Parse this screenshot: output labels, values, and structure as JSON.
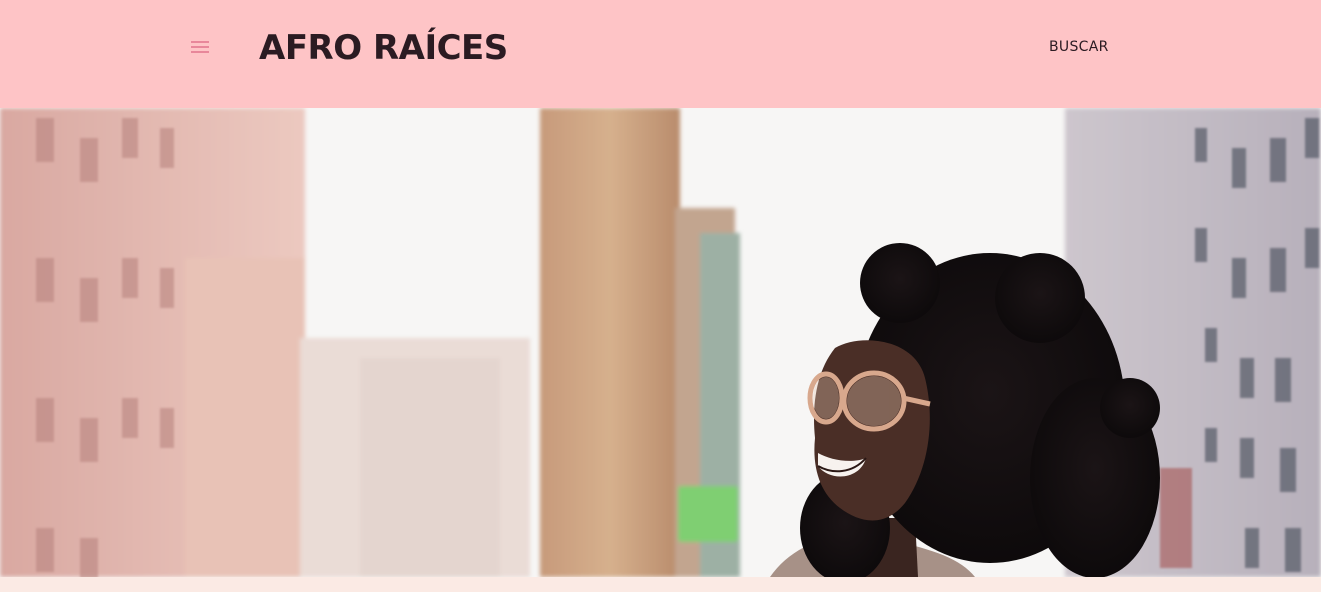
{
  "header": {
    "menu_icon": "hamburger-menu-icon",
    "logo_text": "AFRO RAÍCES",
    "search_label": "BUSCAR",
    "background_color": "#fec4c6",
    "menu_icon_color": "#e8879a",
    "text_color": "#2b1b22"
  },
  "hero": {
    "subject": "hero-photo"
  },
  "page": {
    "bottom_color": "#fbeae4"
  }
}
